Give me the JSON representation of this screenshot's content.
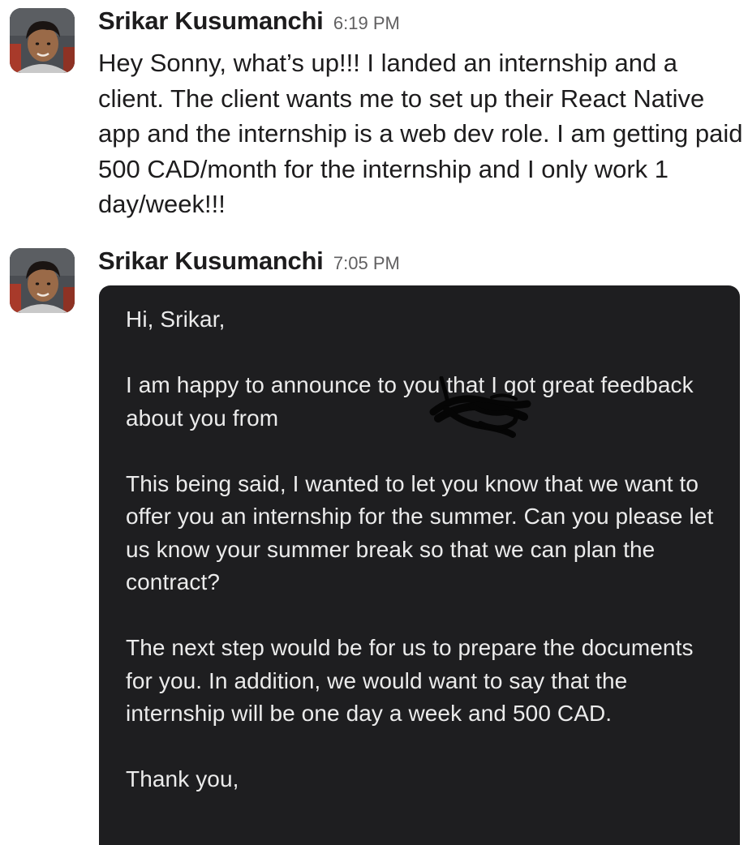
{
  "messages": [
    {
      "sender": "Srikar Kusumanchi",
      "time": "6:19 PM",
      "text": "Hey Sonny, what’s up!!! I landed an internship and a client. The client wants me to set up their React Native app and the internship is a web dev role. I am getting paid 500 CAD/month for the internship and I only work 1 day/week!!!"
    },
    {
      "sender": "Srikar Kusumanchi",
      "time": "7:05 PM",
      "attachment": {
        "greeting": "Hi, Srikar,",
        "paragraph1": "I am happy to announce to you that I got great feedback about you from",
        "paragraph2": "This being said, I wanted to let you know that we want to offer you an internship for the summer. Can you please let us know your summer break so that we can plan the contract?",
        "paragraph3": "The next step would be for us to prepare the documents for you. In addition, we would want to say that the internship will be one day a week and 500 CAD.",
        "closing": "Thank you,"
      }
    }
  ],
  "icons": {
    "avatar": "user-avatar",
    "redaction": "scribble-redaction"
  },
  "colors": {
    "sender": "#1d1c1d",
    "timestamp": "#616061",
    "attachment_background": "#1e1e20",
    "attachment_text": "#ebebeb"
  }
}
